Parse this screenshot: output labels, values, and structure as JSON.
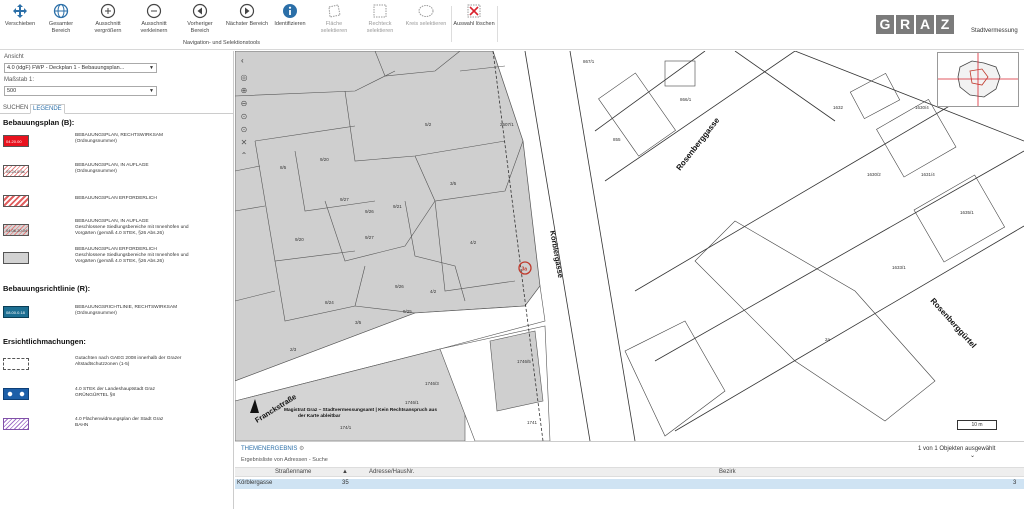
{
  "toolbar": {
    "buttons": [
      {
        "label": "Verschieben",
        "icon": "move-icon"
      },
      {
        "label": "Gesamter Bereich",
        "icon": "globe-icon"
      },
      {
        "label": "Ausschnitt vergrößern",
        "icon": "zoom-in-icon"
      },
      {
        "label": "Ausschnitt verkleinern",
        "icon": "zoom-out-icon"
      },
      {
        "label": "Vorheriger Bereich",
        "icon": "previous-icon"
      },
      {
        "label": "Nächster Bereich",
        "icon": "next-icon"
      },
      {
        "label": "Identifizieren",
        "icon": "info-icon"
      },
      {
        "label": "Fläche selektieren",
        "icon": "polygon-select-icon"
      },
      {
        "label": "Rechteck selektieren",
        "icon": "rectangle-select-icon"
      },
      {
        "label": "Kreis selektieren",
        "icon": "circle-select-icon"
      },
      {
        "label": "Auswahl löschen",
        "icon": "clear-selection-icon"
      }
    ],
    "section_label": "Navigation- und Selektionstools"
  },
  "logo": {
    "letters": [
      "G",
      "R",
      "A",
      "Z"
    ],
    "department": "Stadtvermessung",
    "color": "#7b7b7b"
  },
  "left_panel": {
    "ansicht_label": "Ansicht",
    "ansicht_value": "4.0 (idgF) FWP - Deckplan 1 - Bebauungsplan...",
    "massstab_label": "Maßstab 1:",
    "massstab_value": "500",
    "tabs": [
      "SUCHEN",
      "LEGENDE"
    ],
    "sections": {
      "bebauungsplan": "Bebauungsplan (B):",
      "bebauungsrichtlinie": "Bebauungsrichtlinie (R):",
      "ersichtlichmachungen": "Ersichtlichmachungen:"
    },
    "legend": {
      "b1": {
        "swatch": "04.20.00",
        "text": [
          "BEBAUUNGSPLAN, RECHTSWIRKSAM",
          "(Ordnungsnummer)"
        ]
      },
      "b2": {
        "swatch": "05.24.0.6s",
        "text": [
          "BEBAUUNGSPLAN, IN AUFLAGE",
          "(Ordnungsnummer)"
        ]
      },
      "b3": {
        "text": [
          "BEBAUUNGSPLAN ERFORDERLICH"
        ]
      },
      "b4": {
        "swatch": "04.06.20.04",
        "text": [
          "BEBAUUNGSPLAN, IN AUFLAGE",
          "Geschlossene Siedlungsbereiche mit Innenhöfen und",
          "Vorgärten (gemäß 4.0 STEK, §26 Abs.26)"
        ]
      },
      "b5": {
        "text": [
          "BEBAUUNGSPLAN ERFORDERLICH",
          "Geschlossene Siedlungsbereiche mit Innenhöfen und",
          "Vorgärten (gemäß 4.0 STEK, §26 Abs.26)"
        ]
      },
      "r1": {
        "swatch": "08.00.0.18",
        "text": [
          "BEBAUUNGSRICHTLINIE, RECHTSWIRKSAM",
          "(Ordnungsnummer)"
        ]
      },
      "e1": {
        "text": [
          "Gutachten nach GAEG 2008 innerhalb der Grazer",
          "Altstadtschutzzonen (1-5)"
        ]
      },
      "e2": {
        "text": [
          "4.0 STEK der Landeshauptstadt Graz",
          "GRÜNGÜRTEL §8"
        ]
      },
      "e3": {
        "text": [
          "4.0 Flächenwidmungsplan der Stadt Graz",
          "BAHN"
        ]
      }
    }
  },
  "map": {
    "streets": [
      "Rosenberggasse",
      "Körblergasse",
      "Rosenberggürtel",
      "Franckstraße"
    ],
    "parcels": [
      "867/1",
      "1",
      "855",
      "2607/1",
      "866/1",
      "5/2",
      "9/20",
      "8/5",
      "9/27",
      "9/26",
      "9/21",
      "3/5",
      "4/2",
      "1",
      "9/20",
      "9/27",
      "8/24",
      "9/26",
      "3/5",
      "2/3",
      "9/25",
      "4/2",
      "1746/5",
      "1746/3",
      "1746/4",
      "1746/1",
      "1746/5",
      "174/1",
      "4/3",
      "1741",
      "1632",
      "1630/4",
      "1630/2",
      "1631/4",
      "1630/1",
      "1635/1",
      "1633/1",
      "1635/1",
      "1635/2",
      "1730/2",
      "2a",
      "3a",
      "13"
    ],
    "disclaimer": [
      "Magistrat Graz – Stadtvermessungsamt | Kein Rechtsanspruch aus",
      "der Karte ableitbar"
    ],
    "scale": "10 m"
  },
  "results": {
    "tab": "THEMENERGEBNIS",
    "count": "1 von 1 Objekten ausgewählt",
    "subtitle": "Ergebnisliste von Adressen - Suche",
    "columns": [
      "Straßenname",
      "Adresse/HausNr.",
      "Bezirk"
    ],
    "row": {
      "street": "Körblergasse",
      "number": "35",
      "district": "3"
    }
  }
}
